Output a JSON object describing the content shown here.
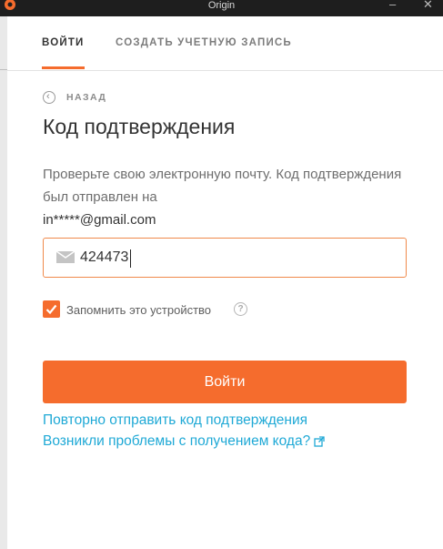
{
  "window": {
    "title": "Origin",
    "minimize": "–",
    "close": "✕"
  },
  "tabs": [
    {
      "label": "ВОЙТИ",
      "active": true
    },
    {
      "label": "СОЗДАТЬ УЧЕТНУЮ ЗАПИСЬ",
      "active": false
    }
  ],
  "back": {
    "label": "НАЗАД",
    "icon": "chevron-left-icon"
  },
  "heading": "Код подтверждения",
  "description": {
    "text": "Проверьте свою электронную почту. Код подтверждения был отправлен на",
    "email": "in*****@gmail.com"
  },
  "code_input": {
    "value": "424473",
    "icon": "envelope-icon"
  },
  "remember": {
    "label": "Запомнить это устройство",
    "checked": true,
    "help_icon": "question-icon"
  },
  "login_button": {
    "label": "Войти"
  },
  "links": {
    "resend": "Повторно отправить код подтверждения",
    "trouble": "Возникли проблемы с получением кода?"
  },
  "colors": {
    "accent": "#f56c2d",
    "link": "#1fa9d6",
    "titlebar": "#1e1e1e"
  }
}
